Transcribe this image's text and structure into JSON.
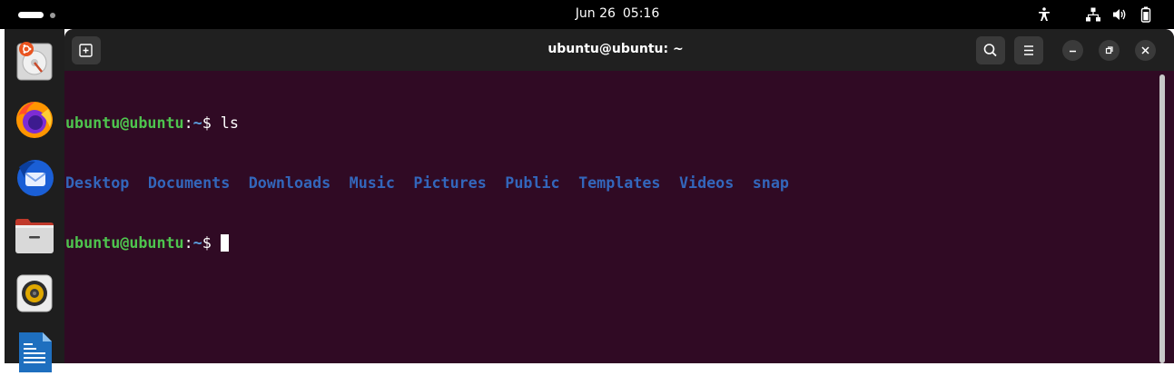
{
  "topbar": {
    "date": "Jun 26",
    "time": "05:16",
    "tray_icons": [
      "accessibility-icon",
      "network-icon",
      "volume-icon",
      "battery-icon"
    ]
  },
  "dock": {
    "items": [
      {
        "name": "ubuntu-installer",
        "icon": "installer-icon"
      },
      {
        "name": "firefox",
        "icon": "firefox-icon"
      },
      {
        "name": "thunderbird",
        "icon": "thunderbird-icon"
      },
      {
        "name": "files",
        "icon": "files-icon"
      },
      {
        "name": "rhythmbox",
        "icon": "rhythmbox-icon"
      },
      {
        "name": "libreoffice-writer",
        "icon": "writer-icon"
      }
    ]
  },
  "window": {
    "title": "ubuntu@ubuntu: ~"
  },
  "terminal": {
    "prompt_user": "ubuntu@ubuntu",
    "prompt_sep": ":",
    "prompt_path": "~",
    "prompt_symbol": "$",
    "command": " ls",
    "listing": [
      "Desktop",
      "Documents",
      "Downloads",
      "Music",
      "Pictures",
      "Public",
      "Templates",
      "Videos",
      "snap"
    ]
  },
  "colors": {
    "terminal_bg": "#300a24",
    "prompt_user": "#4ec44e",
    "prompt_path": "#5ba0e0",
    "directory": "#3366bb",
    "headerbar": "#202020",
    "dock_bg": "#1e1e1e"
  }
}
